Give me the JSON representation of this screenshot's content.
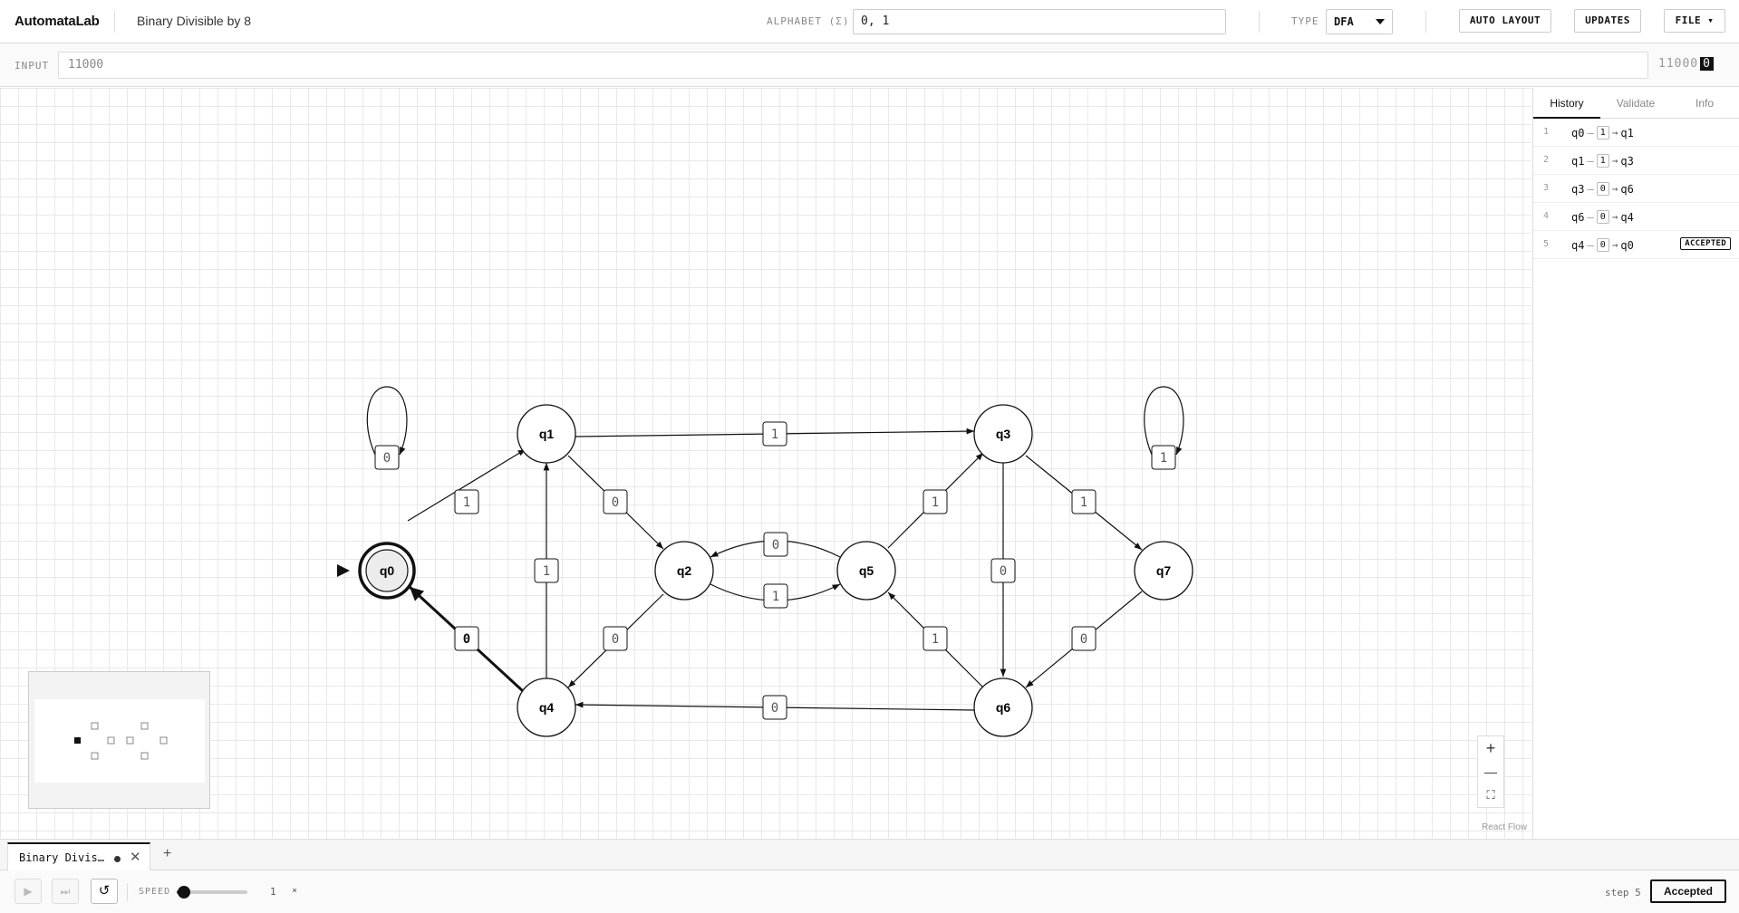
{
  "app": {
    "brand": "AutomataLab",
    "doc_title": "Binary Divisible by 8"
  },
  "toolbar": {
    "alphabet_label": "ALPHABET (Σ)",
    "alphabet_value": "0, 1",
    "type_label": "TYPE",
    "type_value": "DFA",
    "auto_layout": "AUTO LAYOUT",
    "updates": "UPDATES",
    "file": "FILE ▾"
  },
  "input": {
    "label": "INPUT",
    "value": "11000",
    "tape_consumed": "11000",
    "tape_current": "0"
  },
  "graph": {
    "states": [
      {
        "id": "q0",
        "label": "q0",
        "start": true,
        "accepting": true,
        "current": true
      },
      {
        "id": "q1",
        "label": "q1"
      },
      {
        "id": "q2",
        "label": "q2"
      },
      {
        "id": "q3",
        "label": "q3"
      },
      {
        "id": "q4",
        "label": "q4"
      },
      {
        "id": "q5",
        "label": "q5"
      },
      {
        "id": "q6",
        "label": "q6"
      },
      {
        "id": "q7",
        "label": "q7"
      }
    ],
    "transitions": [
      {
        "from": "q0",
        "to": "q0",
        "symbol": "0"
      },
      {
        "from": "q0",
        "to": "q1",
        "symbol": "1"
      },
      {
        "from": "q1",
        "to": "q3",
        "symbol": "1"
      },
      {
        "from": "q1",
        "to": "q2",
        "symbol": "0"
      },
      {
        "from": "q4",
        "to": "q1",
        "symbol": "1"
      },
      {
        "from": "q4",
        "to": "q0",
        "symbol": "0",
        "highlighted": true
      },
      {
        "from": "q2",
        "to": "q4",
        "symbol": "0"
      },
      {
        "from": "q5",
        "to": "q2",
        "symbol": "0"
      },
      {
        "from": "q2",
        "to": "q5",
        "symbol": "1"
      },
      {
        "from": "q5",
        "to": "q3",
        "symbol": "1"
      },
      {
        "from": "q6",
        "to": "q5",
        "symbol": "1"
      },
      {
        "from": "q3",
        "to": "q6",
        "symbol": "0"
      },
      {
        "from": "q3",
        "to": "q7",
        "symbol": "1"
      },
      {
        "from": "q7",
        "to": "q7",
        "symbol": "1"
      },
      {
        "from": "q7",
        "to": "q6",
        "symbol": "0"
      },
      {
        "from": "q6",
        "to": "q4",
        "symbol": "0"
      }
    ]
  },
  "panel": {
    "tabs": [
      "History",
      "Validate",
      "Info"
    ],
    "active_tab": "History",
    "history": [
      {
        "step": "1",
        "from": "q0",
        "symbol": "1",
        "to": "q1"
      },
      {
        "step": "2",
        "from": "q1",
        "symbol": "1",
        "to": "q3"
      },
      {
        "step": "3",
        "from": "q3",
        "symbol": "0",
        "to": "q6"
      },
      {
        "step": "4",
        "from": "q6",
        "symbol": "0",
        "to": "q4"
      },
      {
        "step": "5",
        "from": "q4",
        "symbol": "0",
        "to": "q0",
        "badge": "ACCEPTED"
      }
    ]
  },
  "canvas": {
    "attribution": "React Flow",
    "zoom_in": "+",
    "zoom_out": "—",
    "fit": "⛶"
  },
  "file_tabs": [
    {
      "name": "Binary Divis…",
      "modified": true
    }
  ],
  "file_tab_add": "+",
  "controls": {
    "play_icon": "play-icon",
    "step_icon": "skip-forward-icon",
    "reset_icon": "reset-icon",
    "speed_label": "SPEED",
    "speed_value": "1",
    "speed_unit": "×",
    "speed_fraction": 0.1,
    "step_label": "step 5",
    "result": "Accepted"
  }
}
